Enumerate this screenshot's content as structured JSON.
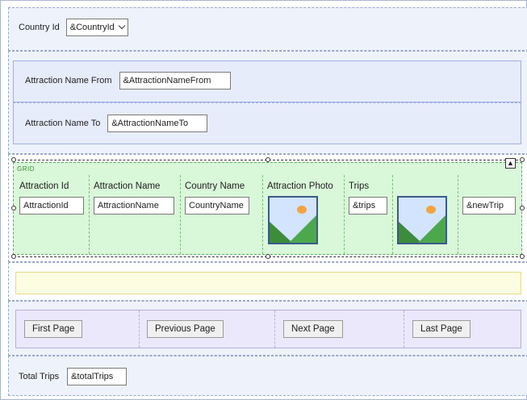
{
  "country": {
    "label": "Country Id",
    "combo_value": "&CountryId"
  },
  "attraction_filters": {
    "from_label": "Attraction Name From",
    "from_value": "&AttractionNameFrom",
    "to_label": "Attraction Name To",
    "to_value": "&AttractionNameTo"
  },
  "grid": {
    "title": "GRID",
    "columns": [
      {
        "header": "Attraction Id",
        "value": "AttractionId"
      },
      {
        "header": "Attraction Name",
        "value": "AttractionName"
      },
      {
        "header": "Country Name",
        "value": "CountryName"
      },
      {
        "header": "Attraction Photo",
        "value": "",
        "icon": "image-placeholder-icon"
      },
      {
        "header": "Trips",
        "value": "&trips"
      },
      {
        "header": "",
        "value": "",
        "icon": "image-placeholder-icon"
      },
      {
        "header": "",
        "value": "&newTrip"
      }
    ]
  },
  "navigation": {
    "first": "First Page",
    "previous": "Previous Page",
    "next": "Next Page",
    "last": "Last Page"
  },
  "totals": {
    "label": "Total Trips",
    "value": "&totalTrips"
  }
}
